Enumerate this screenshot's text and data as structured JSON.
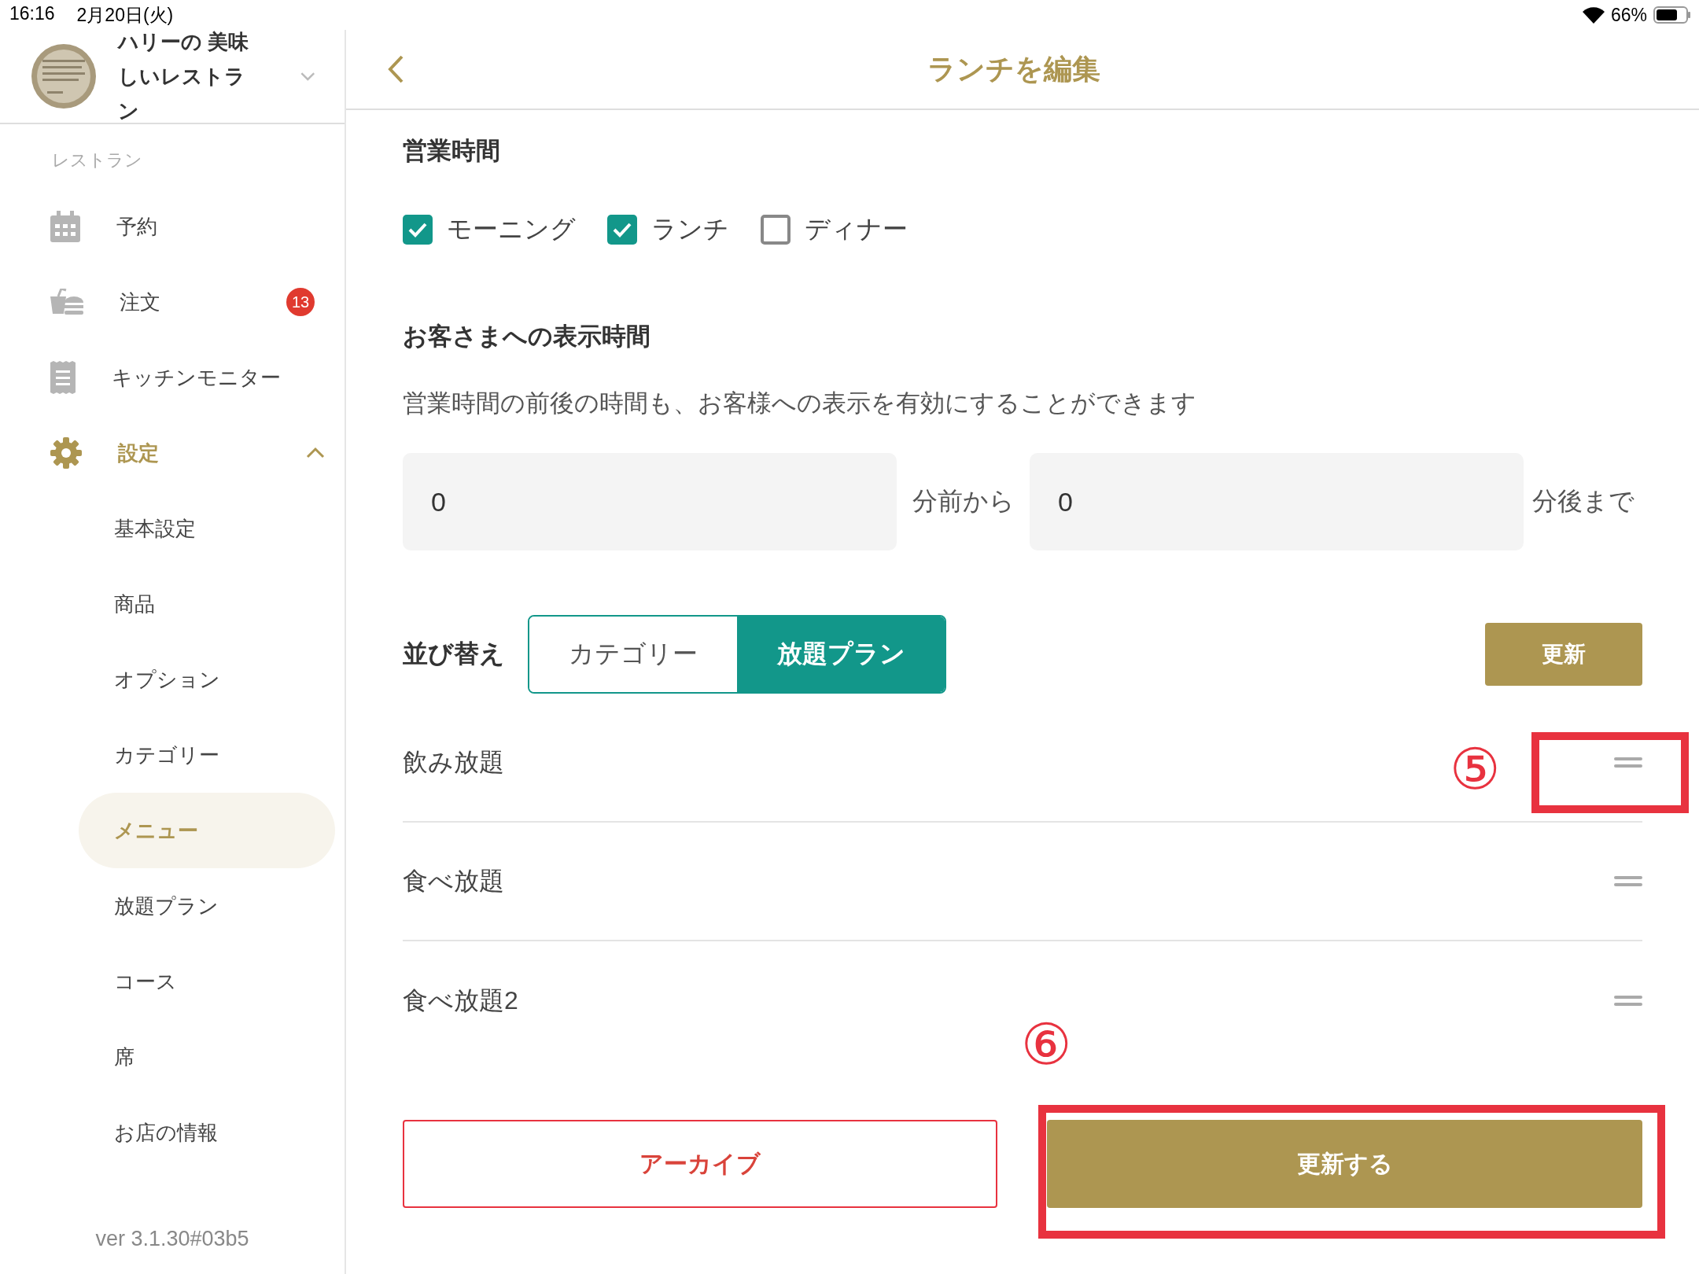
{
  "status_bar": {
    "time": "16:16",
    "date": "2月20日(火)",
    "battery": "66%"
  },
  "sidebar": {
    "restaurant_name": "ハリーの 美味しいレストラン",
    "section_label": "レストラン",
    "items": [
      {
        "label": "予約"
      },
      {
        "label": "注文",
        "badge": "13"
      },
      {
        "label": "キッチンモニター"
      },
      {
        "label": "設定",
        "expanded": true,
        "children": [
          {
            "label": "基本設定",
            "selected": false
          },
          {
            "label": "商品",
            "selected": false
          },
          {
            "label": "オプション",
            "selected": false
          },
          {
            "label": "カテゴリー",
            "selected": false
          },
          {
            "label": "メニュー",
            "selected": true
          },
          {
            "label": "放題プラン",
            "selected": false
          },
          {
            "label": "コース",
            "selected": false
          },
          {
            "label": "席",
            "selected": false
          },
          {
            "label": "お店の情報",
            "selected": false
          }
        ]
      }
    ],
    "version": "ver 3.1.30#03b5"
  },
  "header": {
    "title": "ランチを編集"
  },
  "business_hours": {
    "heading": "営業時間",
    "options": [
      {
        "label": "モーニング",
        "checked": true
      },
      {
        "label": "ランチ",
        "checked": true
      },
      {
        "label": "ディナー",
        "checked": false
      }
    ]
  },
  "display_time": {
    "heading": "お客さまへの表示時間",
    "description": "営業時間の前後の時間も、お客様への表示を有効にすることができます",
    "before": {
      "value": "0",
      "suffix": "分前から"
    },
    "after": {
      "value": "0",
      "suffix": "分後まで"
    }
  },
  "sort": {
    "label": "並び替え",
    "tabs": [
      {
        "label": "カテゴリー",
        "selected": false
      },
      {
        "label": "放題プラン",
        "selected": true
      }
    ],
    "update_button": "更新",
    "rows": [
      {
        "label": "飲み放題"
      },
      {
        "label": "食べ放題"
      },
      {
        "label": "食べ放題2"
      }
    ]
  },
  "actions": {
    "archive": "アーカイブ",
    "submit": "更新する"
  },
  "annotations": [
    {
      "label": "⑤"
    },
    {
      "label": "⑥"
    }
  ]
}
